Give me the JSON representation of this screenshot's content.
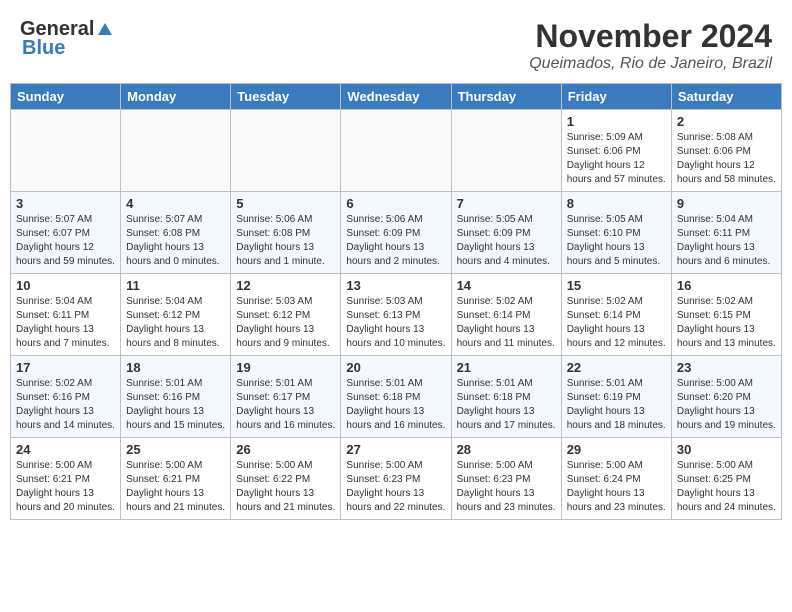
{
  "logo": {
    "general": "General",
    "blue": "Blue"
  },
  "title": "November 2024",
  "location": "Queimados, Rio de Janeiro, Brazil",
  "days_of_week": [
    "Sunday",
    "Monday",
    "Tuesday",
    "Wednesday",
    "Thursday",
    "Friday",
    "Saturday"
  ],
  "weeks": [
    [
      {
        "day": "",
        "info": ""
      },
      {
        "day": "",
        "info": ""
      },
      {
        "day": "",
        "info": ""
      },
      {
        "day": "",
        "info": ""
      },
      {
        "day": "",
        "info": ""
      },
      {
        "day": "1",
        "info": "Sunrise: 5:09 AM\nSunset: 6:06 PM\nDaylight: 12 hours and 57 minutes."
      },
      {
        "day": "2",
        "info": "Sunrise: 5:08 AM\nSunset: 6:06 PM\nDaylight: 12 hours and 58 minutes."
      }
    ],
    [
      {
        "day": "3",
        "info": "Sunrise: 5:07 AM\nSunset: 6:07 PM\nDaylight: 12 hours and 59 minutes."
      },
      {
        "day": "4",
        "info": "Sunrise: 5:07 AM\nSunset: 6:08 PM\nDaylight: 13 hours and 0 minutes."
      },
      {
        "day": "5",
        "info": "Sunrise: 5:06 AM\nSunset: 6:08 PM\nDaylight: 13 hours and 1 minute."
      },
      {
        "day": "6",
        "info": "Sunrise: 5:06 AM\nSunset: 6:09 PM\nDaylight: 13 hours and 2 minutes."
      },
      {
        "day": "7",
        "info": "Sunrise: 5:05 AM\nSunset: 6:09 PM\nDaylight: 13 hours and 4 minutes."
      },
      {
        "day": "8",
        "info": "Sunrise: 5:05 AM\nSunset: 6:10 PM\nDaylight: 13 hours and 5 minutes."
      },
      {
        "day": "9",
        "info": "Sunrise: 5:04 AM\nSunset: 6:11 PM\nDaylight: 13 hours and 6 minutes."
      }
    ],
    [
      {
        "day": "10",
        "info": "Sunrise: 5:04 AM\nSunset: 6:11 PM\nDaylight: 13 hours and 7 minutes."
      },
      {
        "day": "11",
        "info": "Sunrise: 5:04 AM\nSunset: 6:12 PM\nDaylight: 13 hours and 8 minutes."
      },
      {
        "day": "12",
        "info": "Sunrise: 5:03 AM\nSunset: 6:12 PM\nDaylight: 13 hours and 9 minutes."
      },
      {
        "day": "13",
        "info": "Sunrise: 5:03 AM\nSunset: 6:13 PM\nDaylight: 13 hours and 10 minutes."
      },
      {
        "day": "14",
        "info": "Sunrise: 5:02 AM\nSunset: 6:14 PM\nDaylight: 13 hours and 11 minutes."
      },
      {
        "day": "15",
        "info": "Sunrise: 5:02 AM\nSunset: 6:14 PM\nDaylight: 13 hours and 12 minutes."
      },
      {
        "day": "16",
        "info": "Sunrise: 5:02 AM\nSunset: 6:15 PM\nDaylight: 13 hours and 13 minutes."
      }
    ],
    [
      {
        "day": "17",
        "info": "Sunrise: 5:02 AM\nSunset: 6:16 PM\nDaylight: 13 hours and 14 minutes."
      },
      {
        "day": "18",
        "info": "Sunrise: 5:01 AM\nSunset: 6:16 PM\nDaylight: 13 hours and 15 minutes."
      },
      {
        "day": "19",
        "info": "Sunrise: 5:01 AM\nSunset: 6:17 PM\nDaylight: 13 hours and 16 minutes."
      },
      {
        "day": "20",
        "info": "Sunrise: 5:01 AM\nSunset: 6:18 PM\nDaylight: 13 hours and 16 minutes."
      },
      {
        "day": "21",
        "info": "Sunrise: 5:01 AM\nSunset: 6:18 PM\nDaylight: 13 hours and 17 minutes."
      },
      {
        "day": "22",
        "info": "Sunrise: 5:01 AM\nSunset: 6:19 PM\nDaylight: 13 hours and 18 minutes."
      },
      {
        "day": "23",
        "info": "Sunrise: 5:00 AM\nSunset: 6:20 PM\nDaylight: 13 hours and 19 minutes."
      }
    ],
    [
      {
        "day": "24",
        "info": "Sunrise: 5:00 AM\nSunset: 6:21 PM\nDaylight: 13 hours and 20 minutes."
      },
      {
        "day": "25",
        "info": "Sunrise: 5:00 AM\nSunset: 6:21 PM\nDaylight: 13 hours and 21 minutes."
      },
      {
        "day": "26",
        "info": "Sunrise: 5:00 AM\nSunset: 6:22 PM\nDaylight: 13 hours and 21 minutes."
      },
      {
        "day": "27",
        "info": "Sunrise: 5:00 AM\nSunset: 6:23 PM\nDaylight: 13 hours and 22 minutes."
      },
      {
        "day": "28",
        "info": "Sunrise: 5:00 AM\nSunset: 6:23 PM\nDaylight: 13 hours and 23 minutes."
      },
      {
        "day": "29",
        "info": "Sunrise: 5:00 AM\nSunset: 6:24 PM\nDaylight: 13 hours and 23 minutes."
      },
      {
        "day": "30",
        "info": "Sunrise: 5:00 AM\nSunset: 6:25 PM\nDaylight: 13 hours and 24 minutes."
      }
    ]
  ]
}
